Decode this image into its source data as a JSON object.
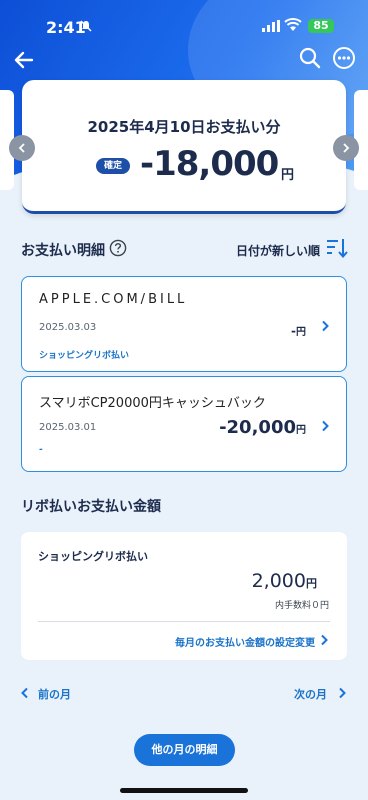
{
  "status_bar": {
    "time": "2:41",
    "battery": "85"
  },
  "icons": {
    "back": "arrow-left-icon",
    "search": "search-icon",
    "more": "more-icon",
    "help": "help-icon",
    "sort": "sort-icon",
    "chevron": "chevron-right-icon"
  },
  "summary": {
    "title": "2025年4月10日お支払い分",
    "status": "確定",
    "amount": "-18,000",
    "unit": "円"
  },
  "details": {
    "heading": "お支払い明細",
    "sort_label": "日付が新しい順",
    "transactions": [
      {
        "merchant": "APPLE.COM/BILL",
        "date": "2025.03.03",
        "amount": "-",
        "unit": "円",
        "type": "ショッピングリボ払い"
      },
      {
        "merchant": "スマリボCP20000円キャッシュバック",
        "date": "2025.03.01",
        "amount": "-20,000",
        "unit": "円",
        "type": "-"
      }
    ]
  },
  "revolving": {
    "heading": "リボ払いお支払い金額",
    "label": "ショッピングリボ払い",
    "amount": "2,000",
    "unit": "円",
    "fee": "内手数料０円",
    "settings_link": "毎月のお支払い金額の設定変更"
  },
  "navigation": {
    "prev_month": "前の月",
    "next_month": "次の月",
    "other_months": "他の月の明細"
  },
  "colors": {
    "primary": "#1a73d8",
    "accent": "#2f8fe0",
    "dark": "#1e4fa8"
  }
}
